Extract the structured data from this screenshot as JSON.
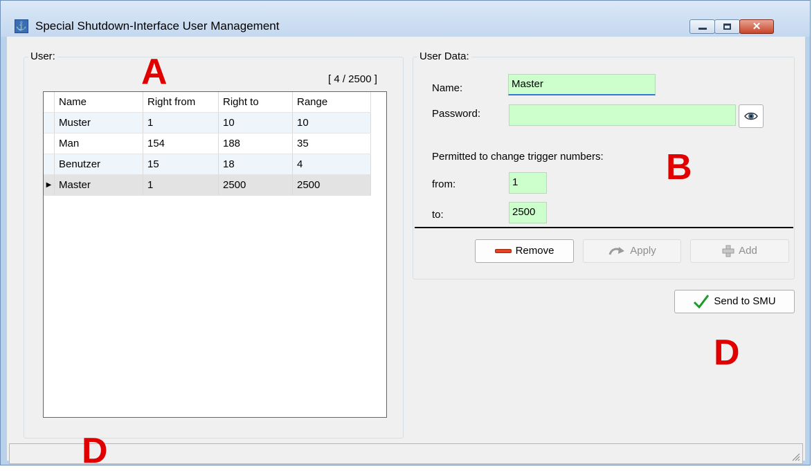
{
  "window": {
    "title": "Special Shutdown-Interface User Management",
    "minimize_icon": "minimize-icon",
    "maximize_icon": "maximize-icon",
    "close_icon": "close-icon",
    "close_glyph": "✕"
  },
  "annotations": {
    "a": "A",
    "b": "B",
    "d_right": "D",
    "d_bottom": "D",
    "color": "#e00000"
  },
  "user_group": {
    "label": "User:",
    "counter": "[ 4 / 2500 ]",
    "columns": [
      "Name",
      "Right from",
      "Right to",
      "Range"
    ],
    "rows": [
      {
        "name": "Muster",
        "right_from": "1",
        "right_to": "10",
        "range": "10"
      },
      {
        "name": "Man",
        "right_from": "154",
        "right_to": "188",
        "range": "35"
      },
      {
        "name": "Benutzer",
        "right_from": "15",
        "right_to": "18",
        "range": "4"
      },
      {
        "name": "Master",
        "right_from": "1",
        "right_to": "2500",
        "range": "2500",
        "selected": true
      }
    ],
    "row_indicator": "▶"
  },
  "user_data": {
    "label": "User Data:",
    "name_label": "Name:",
    "name_value": "Master",
    "password_label": "Password:",
    "password_value": "",
    "show_password_icon": "eye-icon",
    "permitted_label": "Permitted to change trigger numbers:",
    "from_label": "from:",
    "from_value": "1",
    "to_label": "to:",
    "to_value": "2500",
    "field_color": "#ccffcc",
    "remove_label": "Remove",
    "apply_label": "Apply",
    "add_label": "Add"
  },
  "actions": {
    "send_label": "Send to SMU",
    "send_icon": "checkmark-icon"
  }
}
